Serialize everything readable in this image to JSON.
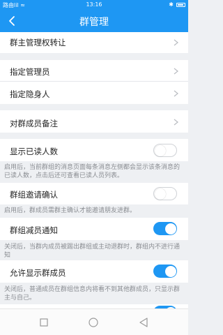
{
  "status": {
    "carrier": "路由lil ≈",
    "time": "13:16"
  },
  "header": {
    "title": "群管理"
  },
  "rows": {
    "transfer_owner": "群主管理权转让",
    "assign_admin": "指定管理员",
    "assign_hidden": "指定隐身人",
    "member_remark": "对群成员备注",
    "show_read_count": "显示已读人数",
    "invite_confirm": "群组邀请确认",
    "decrease_notify": "群组减员通知",
    "allow_show_members": "允许显示群成员"
  },
  "hints": {
    "show_read_count": "启用后，当前群组的消息页面每条消息左侧都会显示该条消息的已读人数，点击后还可查看已读人员列表。",
    "invite_confirm": "启用后，群成员需群主确认才能邀请朋友进群。",
    "decrease_notify": "关闭后，当群内成员被踢出群组或主动退群时，群组内不进行通知",
    "allow_show_members": "关闭后，普通成员在群组信息内将看不到其他群成员，只显示群主与自己。"
  },
  "toggles": {
    "show_read_count": false,
    "invite_confirm": false,
    "decrease_notify": true,
    "allow_show_members": true
  },
  "colors": {
    "accent": "#1e97f3",
    "background": "#eef0f3"
  },
  "icons": {
    "back": "back-arrow-icon",
    "chevron": "chevron-right-icon",
    "nav_back": "triangle-back-icon",
    "nav_home": "circle-home-icon",
    "nav_recent": "square-recent-icon"
  }
}
